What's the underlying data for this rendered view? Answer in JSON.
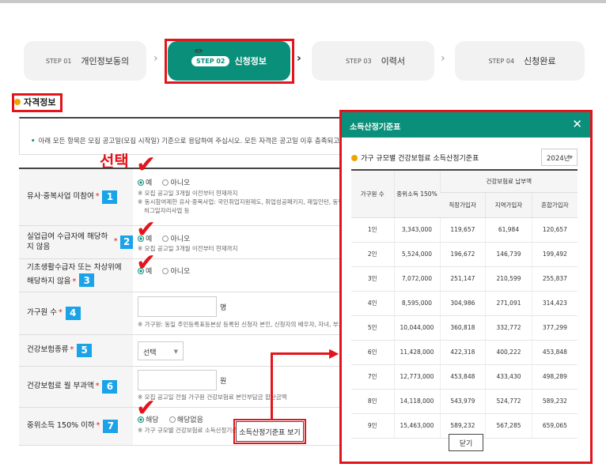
{
  "steps": [
    {
      "num": "STEP 01",
      "label": "개인정보동의"
    },
    {
      "num": "STEP 02",
      "label": "신청정보"
    },
    {
      "num": "STEP 03",
      "label": "이력서"
    },
    {
      "num": "STEP 04",
      "label": "신청완료"
    }
  ],
  "section_title": "자격정보",
  "notice": "아래 모든 항목은 모집 공고일(모집 시작일) 기준으로 응답하여 주십시오. 모든 자격은 공고일 이후 충족되고, 사업참여 기",
  "annotation_select": "선택",
  "rows": [
    {
      "label": "유사·중복사업 미참여",
      "num": "1",
      "opt_yes": "예",
      "opt_no": "아니오",
      "note1": "※ 모집 공고일 3개월 이전부터 현재까지",
      "note2": "※ 동시참여제한 유사·중복사업: 국민취업지원제도, 취업성공패키지, 재일인턴, 동행(",
      "note3": "허그일자리사업 등"
    },
    {
      "label": "실업급여 수급자에 해당하지 않음",
      "num": "2",
      "opt_yes": "예",
      "opt_no": "아니오",
      "note1": "※ 모집 공고일 3개월 이전부터 현재까지"
    },
    {
      "label1": "기초생활수급자 또는 차상위에",
      "label2": "해당하지 않음",
      "num": "3",
      "opt_yes": "예",
      "opt_no": "아니오"
    },
    {
      "label": "가구원 수",
      "num": "4",
      "unit": "명",
      "note1": "※ 가구원: 동일 주민등록표등본상 등록된 신청자 본인, 신청자의 배우자, 자녀, 부모"
    },
    {
      "label": "건강보험종류",
      "num": "5",
      "select": "선택"
    },
    {
      "label": "건강보험료 월 부과액",
      "num": "6",
      "unit": "원",
      "note1": "※ 모집 공고일 전월 가구원 건강보험료 본인부담금 합산금액"
    },
    {
      "label": "중위소득 150% 이하",
      "num": "7",
      "opt_yes": "해당",
      "opt_no": "해당없음",
      "note1": "※ 가구 규모별 건강보험료 소득산정기준",
      "button": "소득산정기준표 보기"
    }
  ],
  "modal": {
    "title": "소득산정기준표",
    "close": "✕",
    "subtitle": "가구 규모별 건강보험료 소득산정기준표",
    "year": "2024년",
    "header_household": "가구원 수",
    "header_median": "중위소득 150%",
    "header_group": "건강보험료 납부액",
    "header_cols": [
      "직장가입자",
      "지역가입자",
      "혼합가입자"
    ],
    "rows": [
      [
        "1인",
        "3,343,000",
        "119,657",
        "61,984",
        "120,657"
      ],
      [
        "2인",
        "5,524,000",
        "196,672",
        "146,739",
        "199,492"
      ],
      [
        "3인",
        "7,072,000",
        "251,147",
        "210,599",
        "255,837"
      ],
      [
        "4인",
        "8,595,000",
        "304,986",
        "271,091",
        "314,423"
      ],
      [
        "5인",
        "10,044,000",
        "360,818",
        "332,772",
        "377,299"
      ],
      [
        "6인",
        "11,428,000",
        "422,318",
        "400,222",
        "453,848"
      ],
      [
        "7인",
        "12,773,000",
        "453,848",
        "433,430",
        "498,289"
      ],
      [
        "8인",
        "14,118,000",
        "543,979",
        "524,772",
        "589,232"
      ],
      [
        "9인",
        "15,463,000",
        "589,232",
        "567,285",
        "659,065"
      ]
    ],
    "close_button": "닫기"
  },
  "colors": {
    "accent": "#0a8f7a",
    "highlight": "#e3141b",
    "badge": "#1aa3e8"
  }
}
